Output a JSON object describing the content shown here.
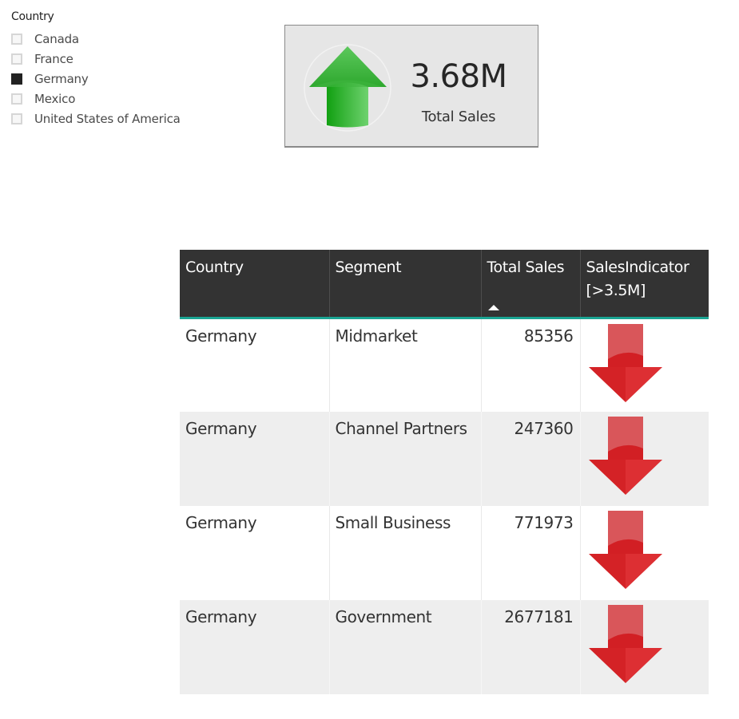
{
  "slicer": {
    "title": "Country",
    "items": [
      {
        "label": "Canada",
        "checked": false
      },
      {
        "label": "France",
        "checked": false
      },
      {
        "label": "Germany",
        "checked": true
      },
      {
        "label": "Mexico",
        "checked": false
      },
      {
        "label": "United States of America",
        "checked": false
      }
    ]
  },
  "kpi": {
    "value": "3.68M",
    "label": "Total Sales",
    "icon": "green-up-arrow-icon",
    "status_color": "#2fb82f"
  },
  "table": {
    "columns": [
      {
        "label": "Country"
      },
      {
        "label": "Segment"
      },
      {
        "label": "Total Sales",
        "sort": "ascending"
      },
      {
        "label": "SalesIndicator [>3.5M]"
      }
    ],
    "header_accent_color": "#1aa493",
    "rows": [
      {
        "country": "Germany",
        "segment": "Midmarket",
        "total_sales": "85356",
        "indicator": "red-down-arrow-icon"
      },
      {
        "country": "Germany",
        "segment": "Channel Partners",
        "total_sales": "247360",
        "indicator": "red-down-arrow-icon"
      },
      {
        "country": "Germany",
        "segment": "Small Business",
        "total_sales": "771973",
        "indicator": "red-down-arrow-icon"
      },
      {
        "country": "Germany",
        "segment": "Government",
        "total_sales": "2677181",
        "indicator": "red-down-arrow-icon"
      }
    ],
    "indicator_color": "#d9232a"
  }
}
